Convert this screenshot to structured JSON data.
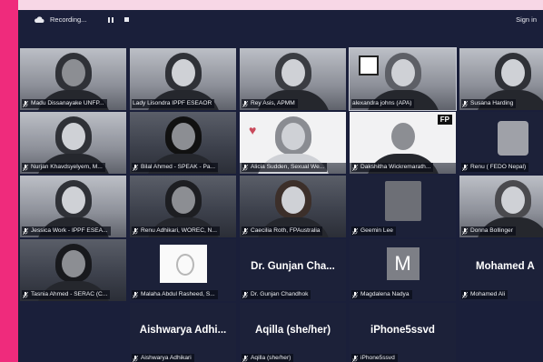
{
  "topbar": {
    "recording_label": "Recording...",
    "signin_label": "Sign in"
  },
  "participants": [
    {
      "name": "Madu Dissanayake UNFP..."
    },
    {
      "name": "Lady Lisondra IPPF ESEAOR"
    },
    {
      "name": "Rey Asis, APMM"
    },
    {
      "name": "alexandra johns (APA)"
    },
    {
      "name": "Susana Harding"
    },
    {
      "name": "Nurjan Khavdsyelyem, M..."
    },
    {
      "name": "Bilal Ahmed - SPEAK - Pa..."
    },
    {
      "name": "Alicia Sudden, Sexual We..."
    },
    {
      "name": "Dakshitha Wickremarath..."
    },
    {
      "name": "Renu ( FEDO Nepal)"
    },
    {
      "name": "Jessica Work - IPPF ESEA..."
    },
    {
      "name": "Renu Adhikari, WOREC, N..."
    },
    {
      "name": "Caecilia Roth, FPAustralia"
    },
    {
      "name": "Geemin Lee"
    },
    {
      "name": "Donna Bollinger"
    },
    {
      "name": "Tasnia Ahmed - SERAC (C..."
    },
    {
      "name": "Malaha Abdul Rasheed, S..."
    },
    {
      "name": "Dr. Gunjan Chandhok",
      "display": "Dr. Gunjan Cha..."
    },
    {
      "name": "Magdalena Nadya",
      "avatar_letter": "M"
    },
    {
      "name": "Mohamed Ali",
      "display": "Mohamed A"
    },
    {
      "name": "Aishwarya Adhikari",
      "display": "Aishwarya Adhi..."
    },
    {
      "name": "Aqilla (she/her)",
      "display": "Aqilla (she/her)"
    },
    {
      "name": "iPhone5ssvd",
      "display": "iPhone5ssvd"
    }
  ],
  "tile_badges": {
    "fp_logo": "FP"
  },
  "icons": {
    "mic_muted": "mic-muted-icon",
    "cloud": "cloud-icon"
  }
}
